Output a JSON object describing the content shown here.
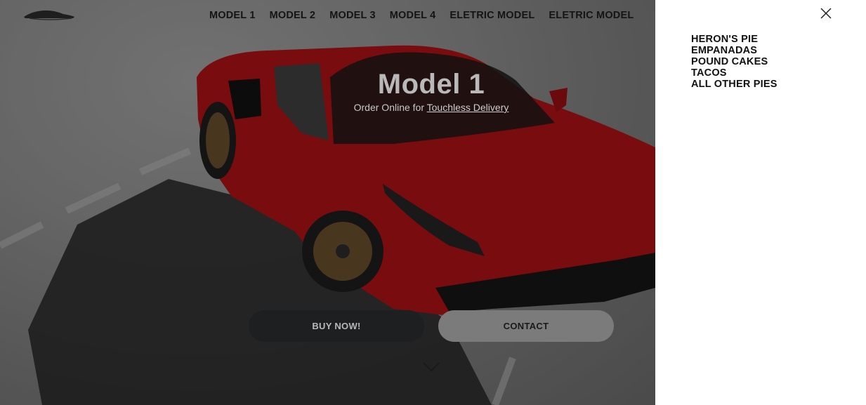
{
  "nav": {
    "items": [
      "MODEL 1",
      "MODEL 2",
      "MODEL 3",
      "MODEL 4",
      "ELETRIC MODEL",
      "ELETRIC MODEL"
    ]
  },
  "hero": {
    "title": "Model 1",
    "subtitle_prefix": "Order Online for",
    "subtitle_link": "Touchless Delivery",
    "buy_label": "BUY NOW!",
    "contact_label": "CONTACT"
  },
  "side_menu": {
    "items": [
      "HERON'S PIE",
      "EMPANADAS",
      "POUND CAKES",
      "TACOS",
      "ALL OTHER PIES"
    ]
  },
  "icons": {
    "logo": "car-logo-icon",
    "close": "close-icon",
    "scroll": "chevron-down-icon"
  },
  "colors": {
    "car_red": "#c8141a",
    "panel_bg": "#ffffff",
    "buy_button_bg": "#1e1f21",
    "contact_button_bg": "#7b7b7b"
  }
}
